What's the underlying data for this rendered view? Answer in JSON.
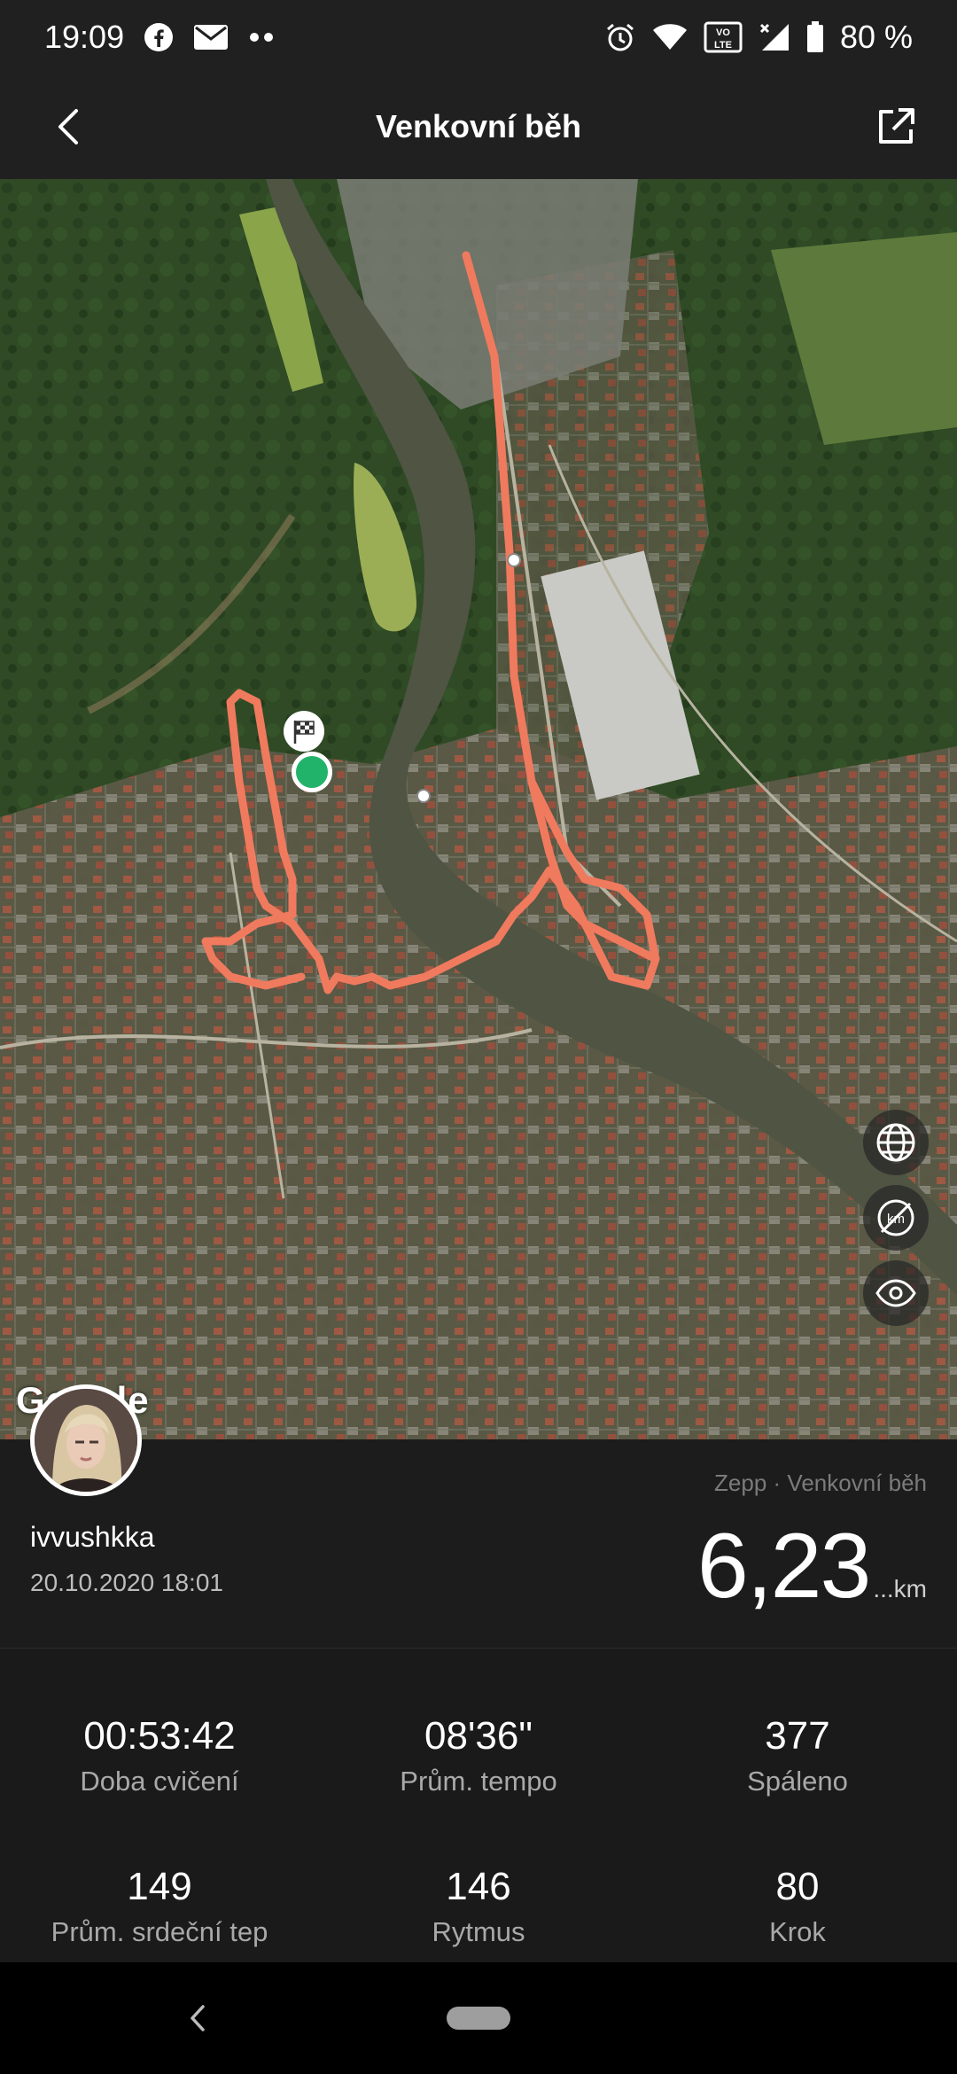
{
  "status_bar": {
    "time": "19:09",
    "battery": "80 %",
    "icons": [
      "facebook-icon",
      "mail-icon",
      "more-dots-icon",
      "alarm-icon",
      "wifi-icon",
      "volte-icon",
      "signal-icon",
      "battery-icon"
    ]
  },
  "app_bar": {
    "title": "Venkovní běh",
    "back_icon": "back-chevron-icon",
    "share_icon": "share-icon"
  },
  "map": {
    "attribution": "Google",
    "route_color": "#f07a5e",
    "start_marker_color": "#22b36b",
    "controls": [
      "globe-icon",
      "km-marker-off-icon",
      "eye-icon"
    ]
  },
  "summary": {
    "username": "ivvushkka",
    "datetime": "20.10.2020 18:01",
    "source": "Zepp · Venkovní běh",
    "distance_value": "6,23",
    "distance_unit": "...km"
  },
  "stats": [
    {
      "value": "00:53:42",
      "label": "Doba cvičení"
    },
    {
      "value": "08'36\"",
      "label": "Prům. tempo"
    },
    {
      "value": "377",
      "label": "Spáleno"
    },
    {
      "value": "149",
      "label": "Prům. srdeční tep"
    },
    {
      "value": "146",
      "label": "Rytmus"
    },
    {
      "value": "80",
      "label": "Krok"
    }
  ]
}
